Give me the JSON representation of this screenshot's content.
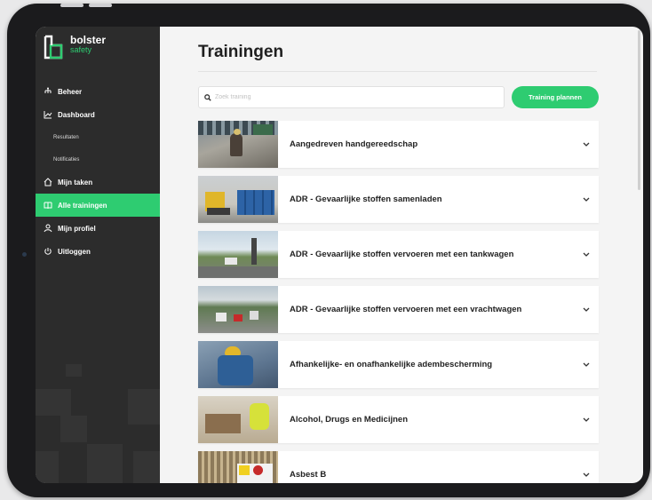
{
  "brand": {
    "name": "bolster",
    "sub": "safety",
    "green": "#2ecc71",
    "dark": "#2c2c2c"
  },
  "sidebar": {
    "items": [
      {
        "label": "Beheer",
        "icon": "org-chart-icon"
      },
      {
        "label": "Dashboard",
        "icon": "chart-line-icon"
      },
      {
        "label": "Resultaten",
        "icon": ""
      },
      {
        "label": "Notificaties",
        "icon": ""
      },
      {
        "label": "Mijn taken",
        "icon": "home-icon"
      },
      {
        "label": "Alle trainingen",
        "icon": "book-icon"
      },
      {
        "label": "Mijn profiel",
        "icon": "user-icon"
      },
      {
        "label": "Uitloggen",
        "icon": "power-icon"
      }
    ]
  },
  "main": {
    "title": "Trainingen",
    "search_placeholder": "Zoek training",
    "plan_button": "Training plannen",
    "trainings": [
      {
        "title": "Aangedreven handgereedschap"
      },
      {
        "title": "ADR - Gevaarlijke stoffen samenladen"
      },
      {
        "title": "ADR - Gevaarlijke stoffen vervoeren met een tankwagen"
      },
      {
        "title": "ADR - Gevaarlijke stoffen vervoeren met een vrachtwagen"
      },
      {
        "title": "Afhankelijke- en onafhankelijke adembescherming"
      },
      {
        "title": "Alcohol, Drugs en Medicijnen"
      },
      {
        "title": "Asbest B"
      }
    ]
  }
}
